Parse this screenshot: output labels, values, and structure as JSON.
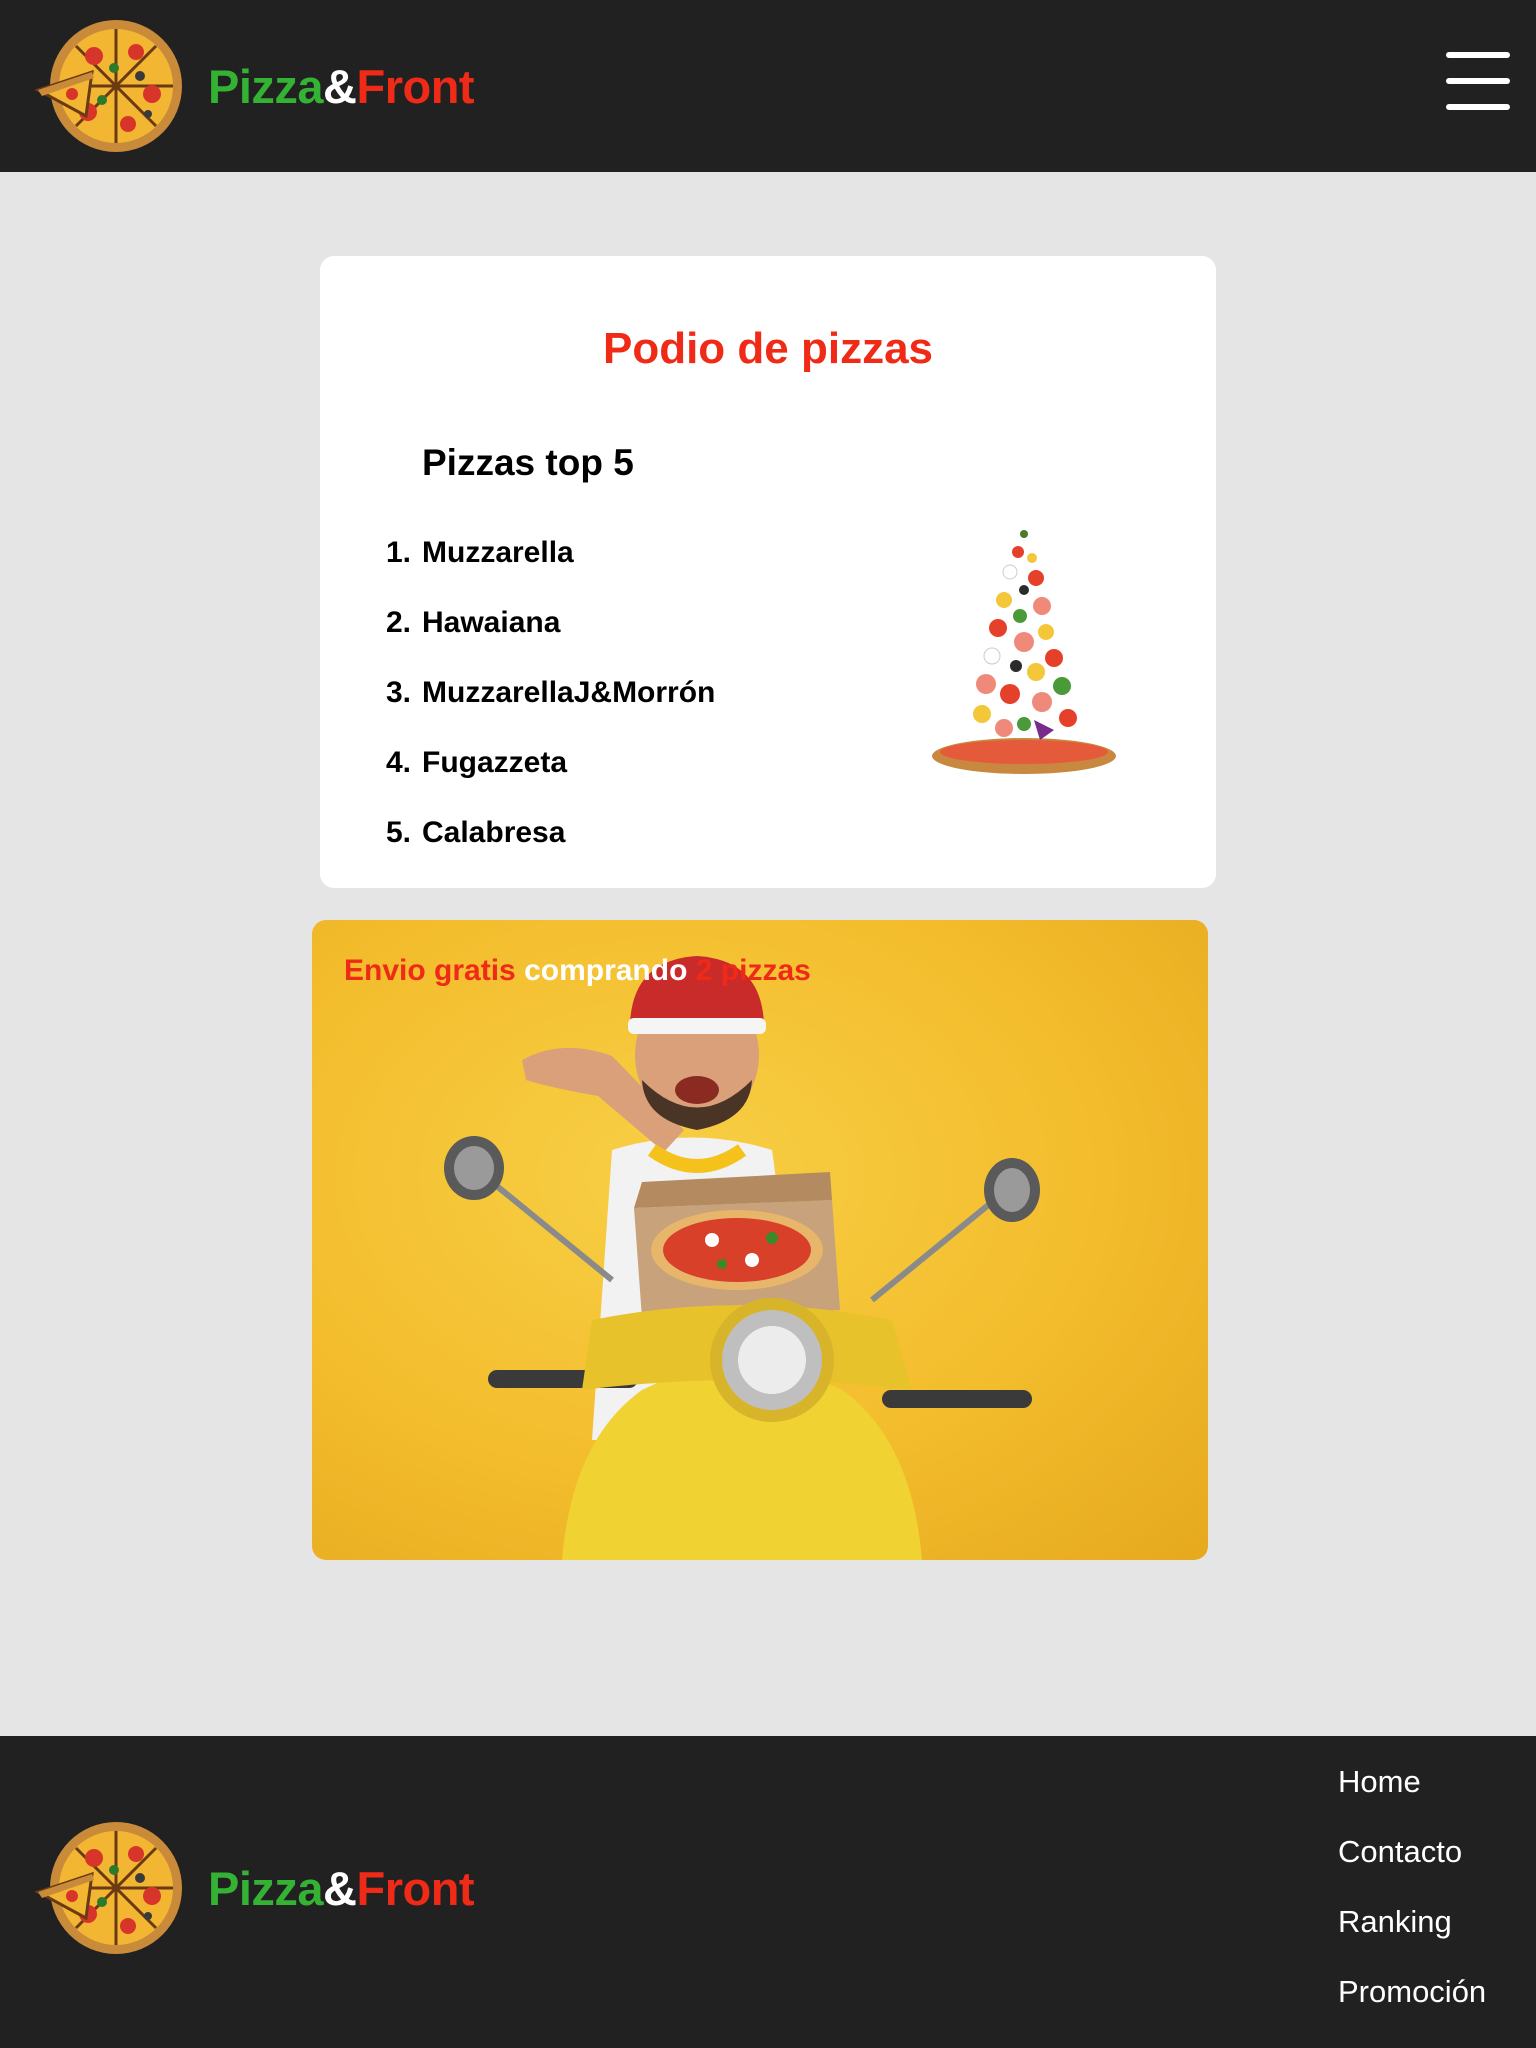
{
  "header": {
    "brand": {
      "part1": "Pizza",
      "part2": "&",
      "part3": "Front"
    },
    "menu_icon": "hamburger-menu-icon"
  },
  "podium": {
    "title": "Podio de pizzas",
    "subtitle": "Pizzas top 5",
    "items": [
      {
        "num": "1.",
        "label": "Muzzarella"
      },
      {
        "num": "2.",
        "label": "Hawaiana"
      },
      {
        "num": "3.",
        "label": "MuzzarellaJ&Morrón"
      },
      {
        "num": "4.",
        "label": "Fugazzeta"
      },
      {
        "num": "5.",
        "label": "Calabresa"
      }
    ]
  },
  "promo": {
    "part1": "Envio gratis",
    "part2": "comprando",
    "part3": "2 pizzas"
  },
  "footer": {
    "brand": {
      "part1": "Pizza",
      "part2": "&",
      "part3": "Front"
    },
    "nav": [
      "Home",
      "Contacto",
      "Ranking",
      "Promoción"
    ]
  },
  "colors": {
    "header_bg": "#212121",
    "page_bg": "#e5e5e5",
    "accent_red": "#ef2b18",
    "accent_green": "#34b233",
    "promo_yellow": "#f3bd2d"
  }
}
